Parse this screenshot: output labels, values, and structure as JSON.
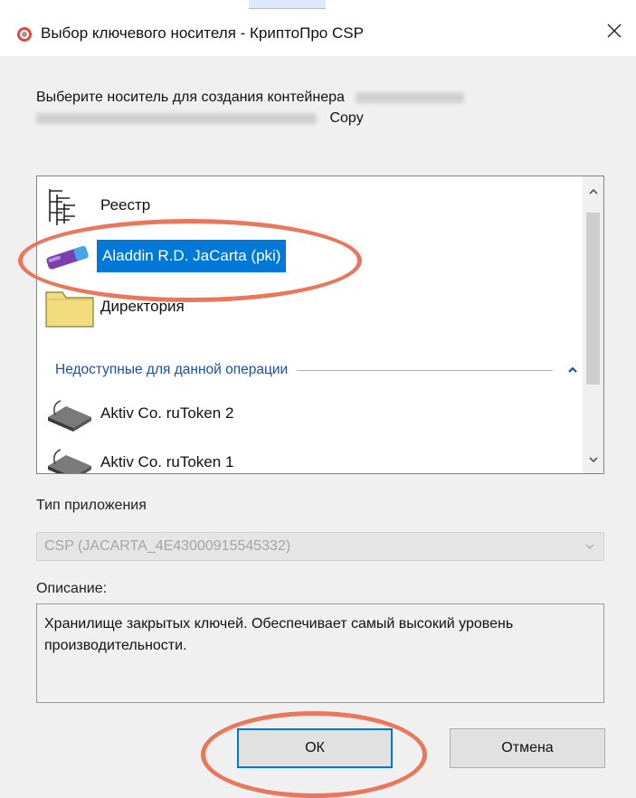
{
  "window": {
    "title": "Выбор ключевого носителя - КриптоПро CSP",
    "close_glyph": "✕"
  },
  "prompt": {
    "line1": "Выберите носитель для создания контейнера",
    "line2_tail": "Copy"
  },
  "media_list": {
    "items": [
      {
        "label": "Реестр",
        "icon": "registry-icon"
      },
      {
        "label": "Aladdin R.D. JaCarta (pki)",
        "icon": "usb-token-icon",
        "selected": true
      },
      {
        "label": "Директория",
        "icon": "folder-icon"
      }
    ],
    "unavailable_group": {
      "title": "Недоступные для данной операции",
      "items": [
        {
          "label": "Aktiv Co. ruToken 2",
          "icon": "smartcard-reader-icon"
        },
        {
          "label": "Aktiv Co. ruToken 1",
          "icon": "smartcard-reader-icon"
        }
      ]
    }
  },
  "app_type": {
    "label": "Тип приложения",
    "value": "CSP (JACARTA_4E43000915545332)"
  },
  "description": {
    "label": "Описание:",
    "text": "Хранилище закрытых ключей. Обеспечивает самый высокий уровень производительности."
  },
  "buttons": {
    "ok": "ОК",
    "cancel": "Отмена"
  },
  "colors": {
    "selection": "#0078d7",
    "annotation": "#e8775b",
    "group_header": "#1d4fa0"
  }
}
